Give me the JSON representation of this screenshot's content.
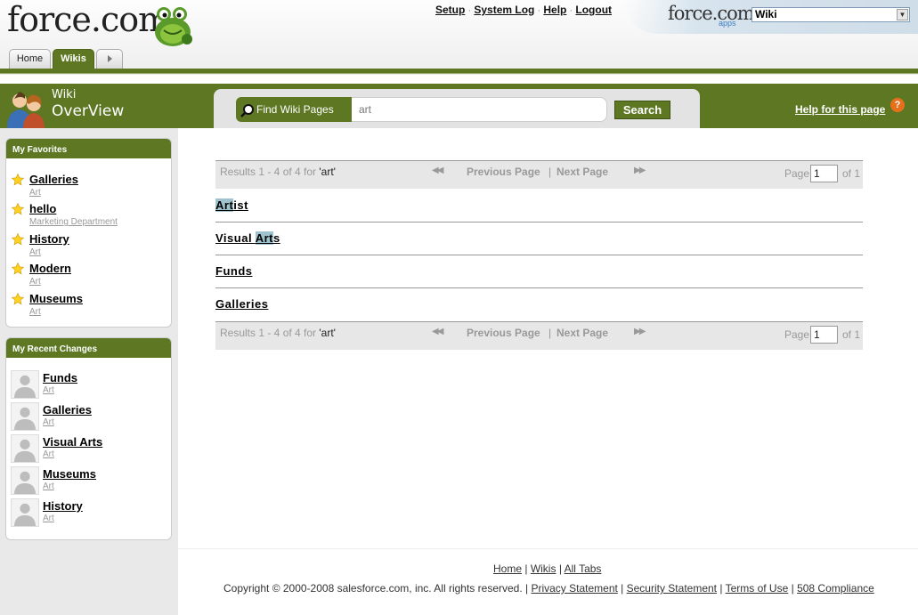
{
  "header": {
    "logo": "force.com",
    "links": [
      "Setup",
      "System Log",
      "Help",
      "Logout"
    ],
    "apps_logo": "force.com",
    "apps_sub": "apps",
    "app_select": "Wiki"
  },
  "tabs": [
    "Home",
    "Wikis"
  ],
  "page": {
    "title_top": "Wiki",
    "title_main": "OverView",
    "search_label": "Find Wiki Pages",
    "search_value": "art",
    "search_button": "Search",
    "help_link": "Help for this page",
    "help_icon": "?"
  },
  "favorites": {
    "heading": "My Favorites",
    "items": [
      {
        "title": "Galleries",
        "sub": "Art"
      },
      {
        "title": "hello",
        "sub": "Marketing Department"
      },
      {
        "title": "History",
        "sub": "Art"
      },
      {
        "title": "Modern",
        "sub": "Art"
      },
      {
        "title": "Museums",
        "sub": "Art"
      }
    ]
  },
  "recent": {
    "heading": "My Recent Changes",
    "items": [
      {
        "title": "Funds",
        "sub": "Art"
      },
      {
        "title": "Galleries",
        "sub": "Art"
      },
      {
        "title": "Visual Arts",
        "sub": "Art"
      },
      {
        "title": "Museums",
        "sub": "Art"
      },
      {
        "title": "History",
        "sub": "Art"
      }
    ]
  },
  "pager": {
    "results_text": "Results 1 - 4 of 4  for ",
    "query": "'art'",
    "first": "◀◀",
    "previous": "Previous Page",
    "separator": "|",
    "next": "Next Page",
    "last": "▶▶",
    "page_label": "Page",
    "page_value": "1",
    "of_text": "of 1"
  },
  "results": [
    {
      "pre": "",
      "hl": "Art",
      "post": "ist"
    },
    {
      "pre": "Visual ",
      "hl": "Art",
      "post": "s"
    },
    {
      "pre": "Funds",
      "hl": "",
      "post": ""
    },
    {
      "pre": "Galleries",
      "hl": "",
      "post": ""
    }
  ],
  "footer": {
    "links": [
      "Home",
      "Wikis",
      "All Tabs"
    ],
    "copyright": "Copyright © 2000-2008 salesforce.com, inc. All rights reserved. | ",
    "legal_links": [
      "Privacy Statement",
      "Security Statement",
      "Terms of Use",
      "508 Compliance"
    ]
  },
  "colors": {
    "brand_green": "#5d7723",
    "highlight": "#9fc2cf",
    "help_orange": "#e6701c"
  },
  "icons": [
    "frog-logo-icon",
    "people-icon",
    "magnifier-icon",
    "star-icon",
    "user-avatar-icon",
    "help-icon",
    "chevron-down-icon",
    "play-icon"
  ]
}
